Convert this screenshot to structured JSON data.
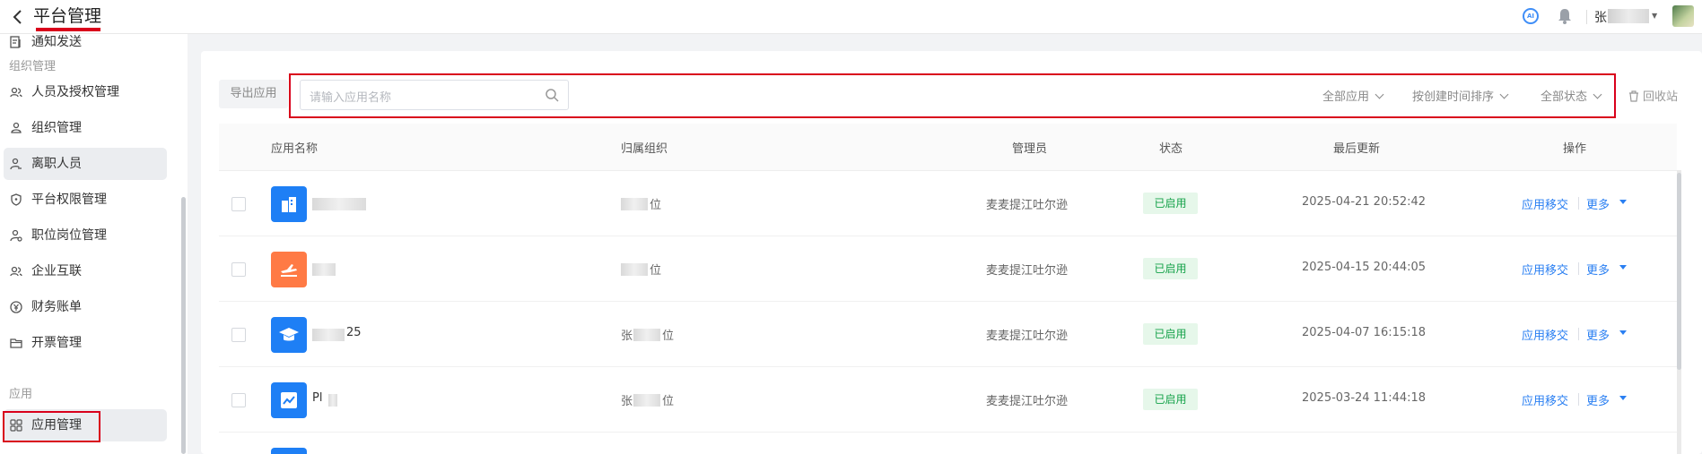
{
  "header": {
    "title": "平台管理",
    "user_name": "张",
    "ai_badge": "AI",
    "icons": [
      "back-icon",
      "ai-assistant-icon",
      "bell-icon",
      "avatar"
    ]
  },
  "sidebar": {
    "items": [
      {
        "label": "通知发送",
        "icon": "send-list-icon"
      },
      {
        "group": "组织管理"
      },
      {
        "label": "人员及授权管理",
        "icon": "users-icon"
      },
      {
        "label": "组织管理",
        "icon": "org-tree-icon"
      },
      {
        "label": "离职人员",
        "icon": "user-leave-icon",
        "active": true
      },
      {
        "label": "平台权限管理",
        "icon": "shield-icon"
      },
      {
        "label": "职位岗位管理",
        "icon": "position-icon"
      },
      {
        "label": "企业互联",
        "icon": "link-users-icon"
      },
      {
        "label": "财务账单",
        "icon": "yen-icon"
      },
      {
        "label": "开票管理",
        "icon": "folder-icon"
      },
      {
        "group": "应用"
      },
      {
        "label": "应用管理",
        "icon": "apps-grid-icon",
        "active": true
      }
    ]
  },
  "toolbar": {
    "export_label": "导出应用",
    "search_placeholder": "请输入应用名称",
    "filter_all_apps": "全部应用",
    "filter_sort": "按创建时间排序",
    "filter_status": "全部状态",
    "recycle_bin": "回收站"
  },
  "table": {
    "columns": [
      "应用名称",
      "归属组织",
      "管理员",
      "状态",
      "最后更新",
      "操作"
    ],
    "rows": [
      {
        "icon": "building-icon",
        "icon_color": "#1e7ff5",
        "name": "",
        "org": "位",
        "admin": "麦麦提江吐尔逊",
        "status": "已启用",
        "updated": "2025-04-21 20:52:42",
        "transfer": "应用移交",
        "more": "更多"
      },
      {
        "icon": "plane-icon",
        "icon_color": "#ff7a45",
        "name": "",
        "org": "位",
        "admin": "麦麦提江吐尔逊",
        "status": "已启用",
        "updated": "2025-04-15 20:44:05",
        "transfer": "应用移交",
        "more": "更多"
      },
      {
        "icon": "graduation-cap-icon",
        "icon_color": "#1e7ff5",
        "name": "25",
        "org": "张",
        "org_tail": "位",
        "admin": "麦麦提江吐尔逊",
        "status": "已启用",
        "updated": "2025-04-07 16:15:18",
        "transfer": "应用移交",
        "more": "更多"
      },
      {
        "icon": "trend-chart-icon",
        "icon_color": "#1e7ff5",
        "name": "Pl",
        "org": "张",
        "org_tail": "位",
        "admin": "麦麦提江吐尔逊",
        "status": "已启用",
        "updated": "2025-03-24 11:44:18",
        "transfer": "应用移交",
        "more": "更多"
      }
    ]
  },
  "colors": {
    "accent": "#2a7ff2",
    "status_green": "#15a24a",
    "annotation_red": "#d9001b"
  }
}
